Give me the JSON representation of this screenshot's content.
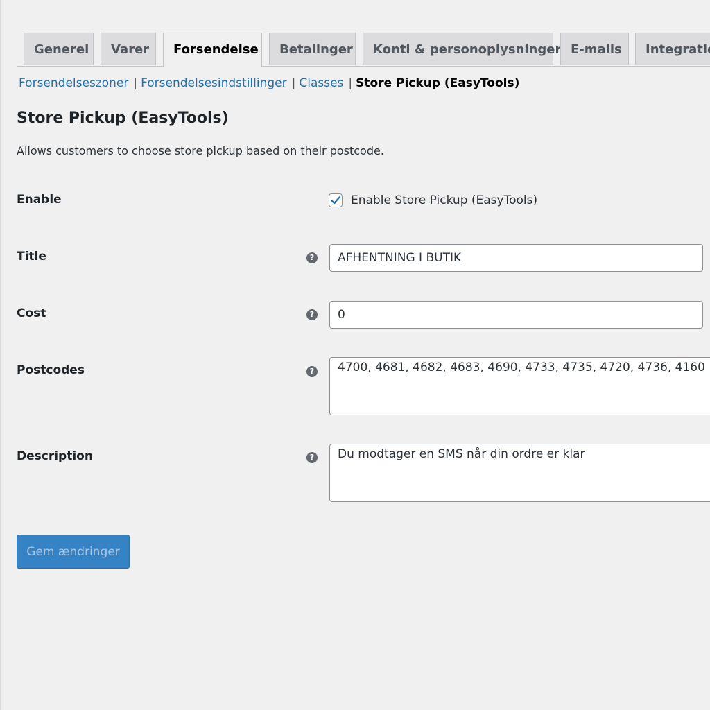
{
  "tabs": [
    {
      "label": "Generel"
    },
    {
      "label": "Varer"
    },
    {
      "label": "Forsendelse"
    },
    {
      "label": "Betalinger"
    },
    {
      "label": "Konti & personoplysninger"
    },
    {
      "label": "E-mails"
    },
    {
      "label": "Integration"
    }
  ],
  "subnav": {
    "items": [
      {
        "label": "Forsendelseszoner"
      },
      {
        "label": "Forsendelsesindstillinger"
      },
      {
        "label": "Classes"
      },
      {
        "label": "Store Pickup (EasyTools)"
      }
    ],
    "separator": "|"
  },
  "section": {
    "title": "Store Pickup (EasyTools)",
    "description": "Allows customers to choose store pickup based on their postcode."
  },
  "fields": {
    "enable": {
      "label": "Enable",
      "checkbox_label": "Enable Store Pickup (EasyTools)",
      "checked": true
    },
    "title": {
      "label": "Title",
      "value": "AFHENTNING I BUTIK"
    },
    "cost": {
      "label": "Cost",
      "value": "0"
    },
    "postcodes": {
      "label": "Postcodes",
      "value": "4700, 4681, 4682, 4683, 4690, 4733, 4735, 4720, 4736, 4160"
    },
    "description": {
      "label": "Description",
      "value": "Du modtager en SMS når din ordre er klar"
    }
  },
  "icons": {
    "help": "?",
    "check": "checkmark-icon"
  },
  "save_button": {
    "label": "Gem ændringer"
  },
  "colors": {
    "accent": "#2271b1",
    "button": "#3582c4",
    "background": "#f0f0f1"
  }
}
